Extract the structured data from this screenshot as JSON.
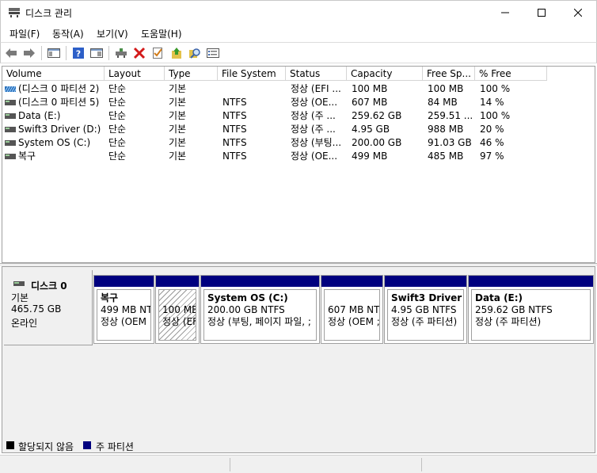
{
  "window": {
    "title": "디스크 관리"
  },
  "menu": [
    "파일(F)",
    "동작(A)",
    "보기(V)",
    "도움말(H)"
  ],
  "toolbar": [
    "back-icon",
    "forward-icon",
    "console-tree-icon",
    "help-icon",
    "list-icon",
    "connect-icon",
    "delete-icon",
    "properties-icon",
    "up-icon",
    "search-icon",
    "details-icon"
  ],
  "volume_list": {
    "columns": [
      "Volume",
      "Layout",
      "Type",
      "File System",
      "Status",
      "Capacity",
      "Free Sp...",
      "% Free"
    ],
    "rows": [
      {
        "volume": "(디스크 0 파티션 2)",
        "layout": "단순",
        "type": "기본",
        "fs": "",
        "status": "정상 (EFI ...",
        "capacity": "100 MB",
        "free": "100 MB",
        "pct": "100 %",
        "icon": "striped"
      },
      {
        "volume": "(디스크 0 파티션 5)",
        "layout": "단순",
        "type": "기본",
        "fs": "NTFS",
        "status": "정상 (OE...",
        "capacity": "607 MB",
        "free": "84 MB",
        "pct": "14 %",
        "icon": "plain"
      },
      {
        "volume": "Data (E:)",
        "layout": "단순",
        "type": "기본",
        "fs": "NTFS",
        "status": "정상 (주 ...",
        "capacity": "259.62 GB",
        "free": "259.51 ...",
        "pct": "100 %",
        "icon": "plain"
      },
      {
        "volume": "Swift3 Driver (D:)",
        "layout": "단순",
        "type": "기본",
        "fs": "NTFS",
        "status": "정상 (주 ...",
        "capacity": "4.95 GB",
        "free": "988 MB",
        "pct": "20 %",
        "icon": "plain"
      },
      {
        "volume": "System OS (C:)",
        "layout": "단순",
        "type": "기본",
        "fs": "NTFS",
        "status": "정상 (부팅...",
        "capacity": "200.00 GB",
        "free": "91.03 GB",
        "pct": "46 %",
        "icon": "plain"
      },
      {
        "volume": "복구",
        "layout": "단순",
        "type": "기본",
        "fs": "NTFS",
        "status": "정상 (OE...",
        "capacity": "499 MB",
        "free": "485 MB",
        "pct": "97 %",
        "icon": "plain"
      }
    ]
  },
  "disk": {
    "name": "디스크 0",
    "type": "기본",
    "size": "465.75 GB",
    "state": "온라인",
    "partitions": [
      {
        "title": "복구",
        "size": "499 MB NT",
        "status": "정상 (OEM",
        "hatched": false
      },
      {
        "title": "",
        "size": "100 ME",
        "status": "정상 (EF",
        "hatched": true
      },
      {
        "title": "System OS  (C:)",
        "size": "200.00 GB NTFS",
        "status": "정상 (부팅, 페이지 파일, ;",
        "hatched": false
      },
      {
        "title": "",
        "size": "607 MB NTI",
        "status": "정상 (OEM ;",
        "hatched": false
      },
      {
        "title": "Swift3 Driver  (I",
        "size": "4.95 GB NTFS",
        "status": "정상 (주 파티션)",
        "hatched": false
      },
      {
        "title": "Data  (E:)",
        "size": "259.62 GB NTFS",
        "status": "정상 (주 파티션)",
        "hatched": false
      }
    ]
  },
  "legend": [
    {
      "label": "할당되지 않음",
      "color": "#000000"
    },
    {
      "label": "주 파티션",
      "color": "#00007f"
    }
  ]
}
